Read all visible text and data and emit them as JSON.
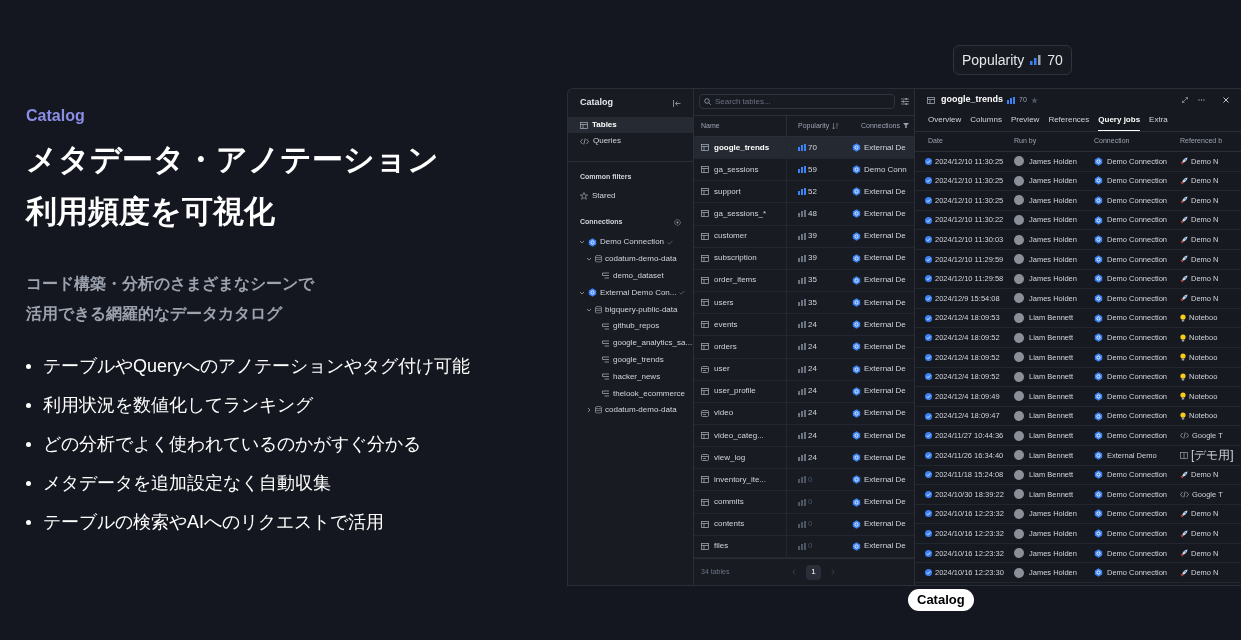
{
  "intro": {
    "eyebrow": "Catalog",
    "heading": [
      "メタデータ・アノテーション",
      "利用頻度を可視化"
    ],
    "subtitle": [
      "コード構築・分析のさまざまなシーンで",
      "活用できる網羅的なデータカタログ"
    ],
    "bullets": [
      "テーブルやQueryへのアノテーションやタグ付け可能",
      "利用状況を数値化してランキング",
      "どの分析でよく使われているのかがすぐ分かる",
      "メタデータを追加設定なく自動収集",
      "テーブルの検索やAIへのリクエストで活用"
    ]
  },
  "tooltip": {
    "label": "Popularity",
    "value": "70"
  },
  "badge": "Catalog",
  "sidebar": {
    "title": "Catalog",
    "nav": [
      {
        "label": "Tables",
        "kind": "table",
        "selected": true
      },
      {
        "label": "Queries",
        "kind": "code",
        "selected": false
      }
    ],
    "filters_title": "Common filters",
    "filters": [
      {
        "label": "Stared"
      }
    ],
    "connections_title": "Connections",
    "tree": [
      {
        "label": "Demo Connection",
        "kind": "connection",
        "expanded": true,
        "children": [
          {
            "label": "codatum-demo-data",
            "kind": "database",
            "expanded": true,
            "children": [
              {
                "label": "demo_dataset",
                "kind": "dataset"
              }
            ]
          }
        ]
      },
      {
        "label": "External Demo Con...",
        "kind": "connection",
        "expanded": true,
        "children": [
          {
            "label": "bigquery-public-data",
            "kind": "database",
            "expanded": true,
            "children": [
              {
                "label": "github_repos",
                "kind": "dataset"
              },
              {
                "label": "google_analytics_sa...",
                "kind": "dataset"
              },
              {
                "label": "google_trends",
                "kind": "dataset"
              },
              {
                "label": "hacker_news",
                "kind": "dataset"
              },
              {
                "label": "thelook_ecommerce",
                "kind": "dataset"
              }
            ]
          },
          {
            "label": "codatum-demo-data",
            "kind": "database",
            "expanded": false
          }
        ]
      }
    ]
  },
  "table": {
    "search_placeholder": "Search tables...",
    "columns": [
      "Name",
      "Popularity",
      "Connections"
    ],
    "rows": [
      {
        "name": "google_trends",
        "kind": "table",
        "popularity": "70",
        "color": "#3b82f6",
        "connection": "External De",
        "selected": true
      },
      {
        "name": "ga_sessions",
        "kind": "table",
        "popularity": "59",
        "color": "#3b82f6",
        "connection": "Demo Conn",
        "selected": false
      },
      {
        "name": "support",
        "kind": "table",
        "popularity": "52",
        "color": "#3b82f6",
        "connection": "External De",
        "selected": false
      },
      {
        "name": "ga_sessions_*",
        "kind": "table",
        "popularity": "48",
        "color": "#6b7280",
        "connection": "External De",
        "selected": false
      },
      {
        "name": "customer",
        "kind": "table",
        "popularity": "39",
        "color": "#6b7280",
        "connection": "External De",
        "selected": false
      },
      {
        "name": "subscription",
        "kind": "table",
        "popularity": "39",
        "color": "#6b7280",
        "connection": "External De",
        "selected": false
      },
      {
        "name": "order_items",
        "kind": "table",
        "popularity": "35",
        "color": "#6b7280",
        "connection": "External De",
        "selected": false
      },
      {
        "name": "users",
        "kind": "table",
        "popularity": "35",
        "color": "#6b7280",
        "connection": "External De",
        "selected": false
      },
      {
        "name": "events",
        "kind": "table",
        "popularity": "24",
        "color": "#6b7280",
        "connection": "External De",
        "selected": false
      },
      {
        "name": "orders",
        "kind": "table",
        "popularity": "24",
        "color": "#6b7280",
        "connection": "External De",
        "selected": false
      },
      {
        "name": "user",
        "kind": "view",
        "popularity": "24",
        "color": "#6b7280",
        "connection": "External De",
        "selected": false
      },
      {
        "name": "user_profile",
        "kind": "table",
        "popularity": "24",
        "color": "#6b7280",
        "connection": "External De",
        "selected": false
      },
      {
        "name": "video",
        "kind": "view",
        "popularity": "24",
        "color": "#6b7280",
        "connection": "External De",
        "selected": false
      },
      {
        "name": "video_categ...",
        "kind": "table",
        "popularity": "24",
        "color": "#6b7280",
        "connection": "External De",
        "selected": false
      },
      {
        "name": "view_log",
        "kind": "view",
        "popularity": "24",
        "color": "#6b7280",
        "connection": "External De",
        "selected": false
      },
      {
        "name": "inventory_ite...",
        "kind": "table",
        "popularity": "0",
        "color": "#4b5563",
        "connection": "External De",
        "selected": false
      },
      {
        "name": "commits",
        "kind": "table",
        "popularity": "0",
        "color": "#4b5563",
        "connection": "External De",
        "selected": false
      },
      {
        "name": "contents",
        "kind": "table",
        "popularity": "0",
        "color": "#4b5563",
        "connection": "External De",
        "selected": false
      },
      {
        "name": "files",
        "kind": "table",
        "popularity": "0",
        "color": "#4b5563",
        "connection": "External De",
        "selected": false
      }
    ],
    "footer": "34 tables",
    "page": "1"
  },
  "detail": {
    "title": "google_trends",
    "popularity": "70",
    "tabs": [
      {
        "label": "Overview",
        "selected": false
      },
      {
        "label": "Columns",
        "selected": false
      },
      {
        "label": "Preview",
        "selected": false
      },
      {
        "label": "References",
        "selected": false
      },
      {
        "label": "Query jobs",
        "selected": true
      },
      {
        "label": "Extra",
        "selected": false
      }
    ],
    "columns": [
      "Date",
      "Run by",
      "Connection",
      "Referenced b"
    ],
    "jobs": [
      {
        "date": "2024/12/10 11:30:25",
        "user": "James Holden",
        "connection": "Demo Connection",
        "ref": "Demo N",
        "kind": "rocket"
      },
      {
        "date": "2024/12/10 11:30:25",
        "user": "James Holden",
        "connection": "Demo Connection",
        "ref": "Demo N",
        "kind": "rocket"
      },
      {
        "date": "2024/12/10 11:30:25",
        "user": "James Holden",
        "connection": "Demo Connection",
        "ref": "Demo N",
        "kind": "rocket"
      },
      {
        "date": "2024/12/10 11:30:22",
        "user": "James Holden",
        "connection": "Demo Connection",
        "ref": "Demo N",
        "kind": "rocket"
      },
      {
        "date": "2024/12/10 11:30:03",
        "user": "James Holden",
        "connection": "Demo Connection",
        "ref": "Demo N",
        "kind": "rocket"
      },
      {
        "date": "2024/12/10 11:29:59",
        "user": "James Holden",
        "connection": "Demo Connection",
        "ref": "Demo N",
        "kind": "rocket"
      },
      {
        "date": "2024/12/10 11:29:58",
        "user": "James Holden",
        "connection": "Demo Connection",
        "ref": "Demo N",
        "kind": "rocket"
      },
      {
        "date": "2024/12/9 15:54:08",
        "user": "James Holden",
        "connection": "Demo Connection",
        "ref": "Demo N",
        "kind": "rocket"
      },
      {
        "date": "2024/12/4 18:09:53",
        "user": "Liam Bennett",
        "connection": "Demo Connection",
        "ref": "Noteboo",
        "kind": "bulb"
      },
      {
        "date": "2024/12/4 18:09:52",
        "user": "Liam Bennett",
        "connection": "Demo Connection",
        "ref": "Noteboo",
        "kind": "bulb"
      },
      {
        "date": "2024/12/4 18:09:52",
        "user": "Liam Bennett",
        "connection": "Demo Connection",
        "ref": "Noteboo",
        "kind": "bulb"
      },
      {
        "date": "2024/12/4 18:09:52",
        "user": "Liam Bennett",
        "connection": "Demo Connection",
        "ref": "Noteboo",
        "kind": "bulb"
      },
      {
        "date": "2024/12/4 18:09:49",
        "user": "Liam Bennett",
        "connection": "Demo Connection",
        "ref": "Noteboo",
        "kind": "bulb"
      },
      {
        "date": "2024/12/4 18:09:47",
        "user": "Liam Bennett",
        "connection": "Demo Connection",
        "ref": "Noteboo",
        "kind": "bulb"
      },
      {
        "date": "2024/11/27 10:44:36",
        "user": "Liam Bennett",
        "connection": "Demo Connection",
        "ref": "Google T",
        "kind": "code"
      },
      {
        "date": "2024/11/26 16:34:40",
        "user": "Liam Bennett",
        "connection": "External Demo",
        "ref": "[デモ用]",
        "kind": "book"
      },
      {
        "date": "2024/11/18 15:24:08",
        "user": "Liam Bennett",
        "connection": "Demo Connection",
        "ref": "Demo N",
        "kind": "rocket"
      },
      {
        "date": "2024/10/30 18:39:22",
        "user": "Liam Bennett",
        "connection": "Demo Connection",
        "ref": "Google T",
        "kind": "code"
      },
      {
        "date": "2024/10/16 12:23:32",
        "user": "James Holden",
        "connection": "Demo Connection",
        "ref": "Demo N",
        "kind": "rocket"
      },
      {
        "date": "2024/10/16 12:23:32",
        "user": "James Holden",
        "connection": "Demo Connection",
        "ref": "Demo N",
        "kind": "rocket"
      },
      {
        "date": "2024/10/16 12:23:32",
        "user": "James Holden",
        "connection": "Demo Connection",
        "ref": "Demo N",
        "kind": "rocket"
      },
      {
        "date": "2024/10/16 12:23:30",
        "user": "James Holden",
        "connection": "Demo Connection",
        "ref": "Demo N",
        "kind": "rocket"
      }
    ]
  }
}
